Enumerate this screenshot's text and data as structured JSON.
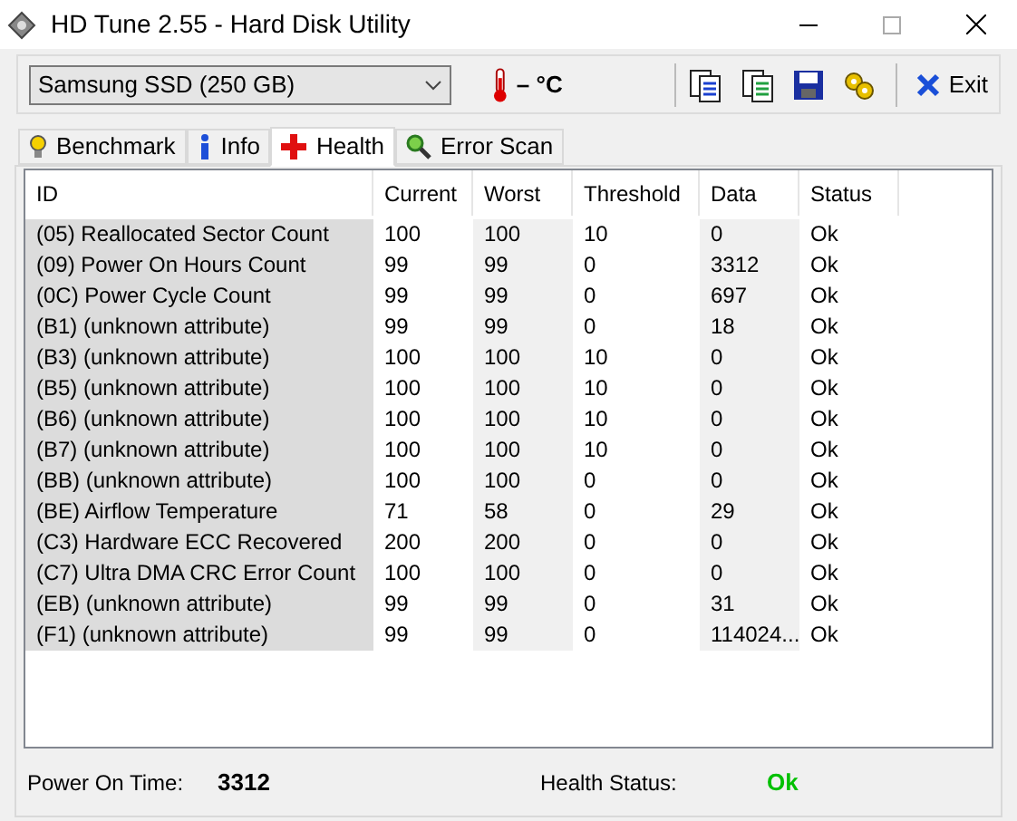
{
  "window": {
    "title": "HD Tune 2.55 - Hard Disk Utility"
  },
  "toolbar": {
    "drive": "Samsung SSD (250 GB)",
    "temperature": "– °C",
    "exit": "Exit"
  },
  "tabs": [
    {
      "label": "Benchmark",
      "selected": false
    },
    {
      "label": "Info",
      "selected": false
    },
    {
      "label": "Health",
      "selected": true
    },
    {
      "label": "Error Scan",
      "selected": false
    }
  ],
  "table": {
    "columns": [
      "ID",
      "Current",
      "Worst",
      "Threshold",
      "Data",
      "Status"
    ],
    "rows": [
      [
        "(05) Reallocated Sector Count",
        "100",
        "100",
        "10",
        "0",
        "Ok"
      ],
      [
        "(09) Power On Hours Count",
        "99",
        "99",
        "0",
        "3312",
        "Ok"
      ],
      [
        "(0C) Power Cycle Count",
        "99",
        "99",
        "0",
        "697",
        "Ok"
      ],
      [
        "(B1) (unknown attribute)",
        "99",
        "99",
        "0",
        "18",
        "Ok"
      ],
      [
        "(B3) (unknown attribute)",
        "100",
        "100",
        "10",
        "0",
        "Ok"
      ],
      [
        "(B5) (unknown attribute)",
        "100",
        "100",
        "10",
        "0",
        "Ok"
      ],
      [
        "(B6) (unknown attribute)",
        "100",
        "100",
        "10",
        "0",
        "Ok"
      ],
      [
        "(B7) (unknown attribute)",
        "100",
        "100",
        "10",
        "0",
        "Ok"
      ],
      [
        "(BB) (unknown attribute)",
        "100",
        "100",
        "0",
        "0",
        "Ok"
      ],
      [
        "(BE) Airflow Temperature",
        "71",
        "58",
        "0",
        "29",
        "Ok"
      ],
      [
        "(C3) Hardware ECC Recovered",
        "200",
        "200",
        "0",
        "0",
        "Ok"
      ],
      [
        "(C7) Ultra DMA CRC Error Count",
        "100",
        "100",
        "0",
        "0",
        "Ok"
      ],
      [
        "(EB) (unknown attribute)",
        "99",
        "99",
        "0",
        "31",
        "Ok"
      ],
      [
        "(F1) (unknown attribute)",
        "99",
        "99",
        "0",
        "114024...",
        "Ok"
      ]
    ]
  },
  "footer": {
    "power_on_label": "Power On Time:",
    "power_on_value": "3312",
    "health_label": "Health Status:",
    "health_value": "Ok"
  }
}
